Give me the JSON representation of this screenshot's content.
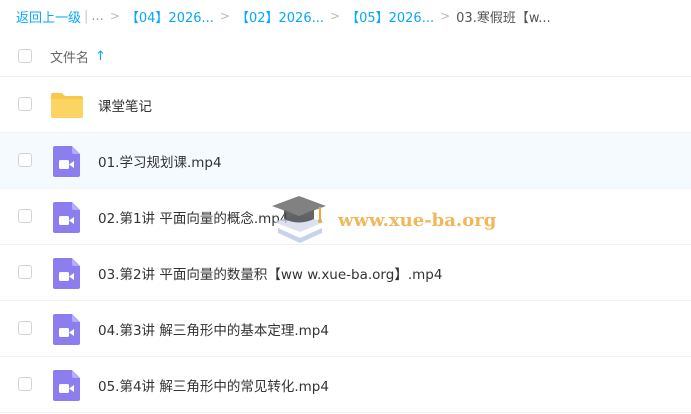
{
  "breadcrumb": {
    "back": "返回上一级",
    "bar": "|",
    "ellipsis": "...",
    "separator": ">",
    "items": [
      "【04】2026...",
      "【02】2026...",
      "【05】2026..."
    ],
    "current": "03.寒假班【w..."
  },
  "header": {
    "name_label": "文件名",
    "sort_arrow": "↑"
  },
  "files": [
    {
      "name": "课堂笔记",
      "type": "folder-icon"
    },
    {
      "name": "01.学习规划课.mp4",
      "type": "video-icon"
    },
    {
      "name": "02.第1讲 平面向量的概念.mp4",
      "type": "video-icon"
    },
    {
      "name": "03.第2讲 平面向量的数量积【ww w.xue-ba.org】.mp4",
      "type": "video-icon"
    },
    {
      "name": "04.第3讲 解三角形中的基本定理.mp4",
      "type": "video-icon"
    },
    {
      "name": "05.第4讲 解三角形中的常见转化.mp4",
      "type": "video-icon"
    }
  ],
  "watermark": {
    "text": "www.xue-ba.org",
    "icon": "graduation-cap-icon"
  },
  "colors": {
    "accent": "#06a7ff",
    "folder": "#f9c84a",
    "video": "#8d7ef0"
  }
}
